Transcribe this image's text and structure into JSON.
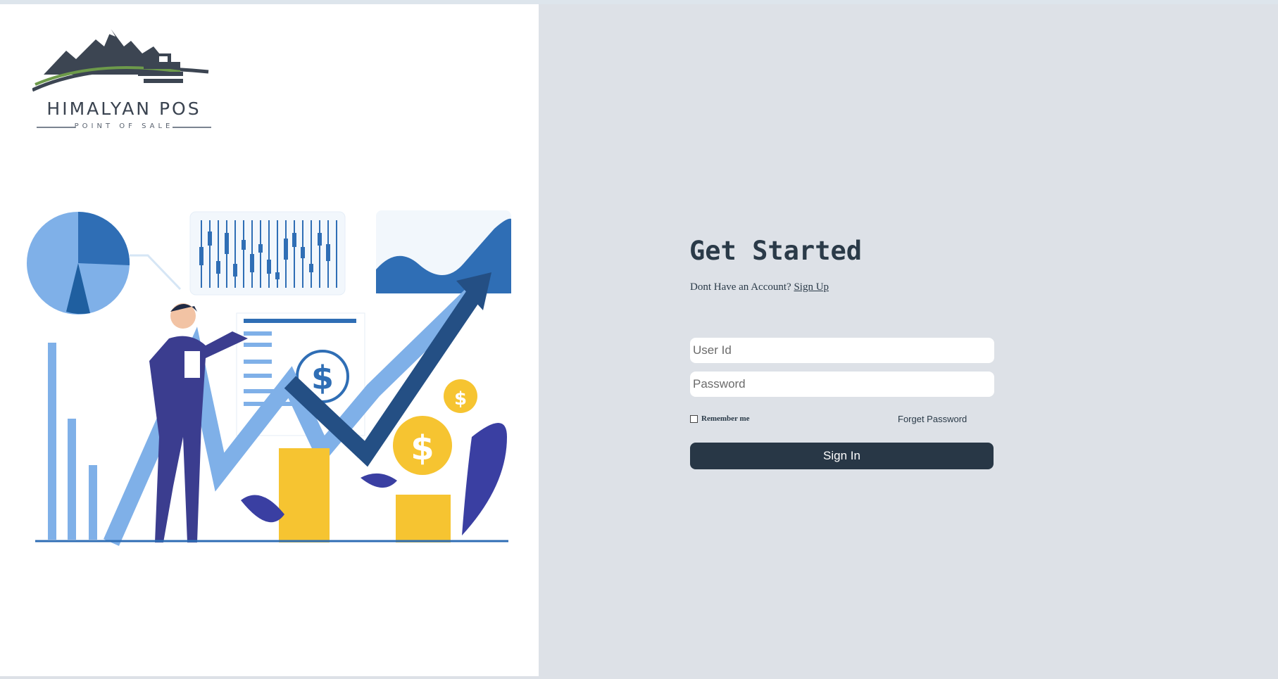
{
  "logo": {
    "title": "HIMALYAN POS",
    "subtitle": "POINT OF SALE"
  },
  "login": {
    "heading": "Get Started",
    "no_account_text": "Dont Have an Account?",
    "signup_link": "Sign Up",
    "user_placeholder": "User Id",
    "password_placeholder": "Password",
    "remember_label": "Remember me",
    "remember_checked": false,
    "forgot_label": "Forget Password",
    "signin_label": "Sign In"
  },
  "colors": {
    "page_background": "#dde1e7",
    "left_panel_background": "#ffffff",
    "primary_button": "#283746",
    "heading_text": "#2a3a48",
    "chart_blue_dark": "#2f6eb5",
    "chart_blue_light": "#7fb0e8",
    "coin_gold": "#f6c431"
  }
}
